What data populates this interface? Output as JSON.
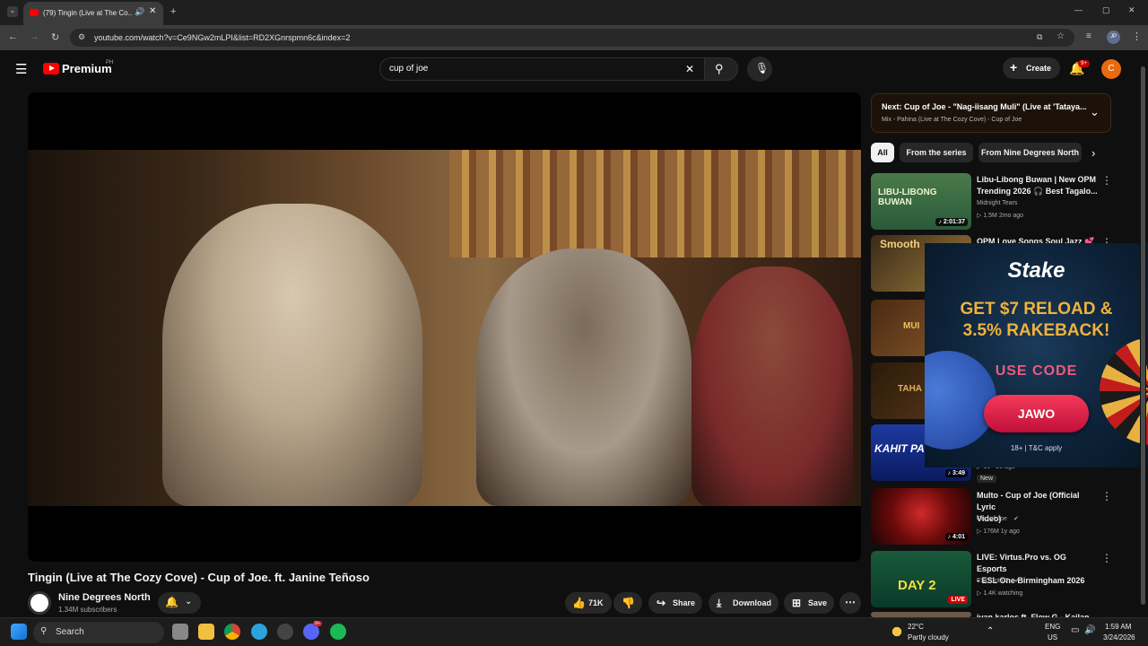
{
  "browser": {
    "tab_title": "(79) Tingin (Live at The Co...",
    "url": "youtube.com/watch?v=Ce9NGw2mLPI&list=RD2XGnrspmn6c&index=2",
    "profile": "JP"
  },
  "header": {
    "brand": "Premium",
    "country": "PH",
    "search_value": "cup of joe",
    "create_label": "Create",
    "notif_count": "9+",
    "avatar_letter": "C"
  },
  "video": {
    "title": "Tingin (Live at The Cozy Cove) - Cup of Joe. ft. Janine Teñoso",
    "channel": "Nine Degrees North",
    "subscribers": "1.34M subscribers",
    "likes": "71K",
    "share_label": "Share",
    "download_label": "Download",
    "save_label": "Save"
  },
  "next": {
    "title": "Next: Cup of Joe - \"Nag-iisang Muli\" (Live at 'Tataya...",
    "mix": "Mix - Pahina (Live at The Cozy Cove) - Cup of Joe"
  },
  "chips": [
    "All",
    "From the series",
    "From Nine Degrees North"
  ],
  "recs": [
    {
      "title_1": "Libu-Libong Buwan | New OPM",
      "title_2": "Trending 2026 🎧 Best Tagalo...",
      "channel": "Midnight Tears",
      "meta": "▷ 1.5M   2mo ago",
      "duration": "♪ 2:01:37",
      "thumb_text": "LIBU-LIBONG BUWAN"
    },
    {
      "title_1": "OPM Love Songs Soul Jazz 💕",
      "thumb_text": "Smooth"
    },
    {
      "thumb_text": "MUI"
    },
    {
      "thumb_text": "TAHA"
    },
    {
      "meta": "▷ 16 · 26 ago",
      "badge": "New",
      "duration": "♪ 3:49",
      "thumb_text": "KAHIT PA"
    },
    {
      "title_1": "Multo - Cup of Joe (Official Lyric",
      "title_2": "Video)",
      "channel": "Cup of Joe",
      "meta": "▷ 176M   1y ago",
      "duration": "♪ 4:01"
    },
    {
      "title_1": "LIVE: Virtus.Pro vs. OG Esports",
      "title_2": "- ESL One Birmingham 2026",
      "channel": "ESL Dota 2",
      "meta": "▷ 1.4K watching",
      "badge": "LIVE",
      "thumb_text": "DAY 2"
    },
    {
      "title_1": "ivan karlos ft. Flow G - Kailan"
    }
  ],
  "ad": {
    "logo": "Stake",
    "headline_1": "GET $7 RELOAD &",
    "headline_2": "3.5% RAKEBACK!",
    "use_code": "USE CODE",
    "code": "JAWO",
    "terms": "18+ | T&C apply"
  },
  "taskbar": {
    "search": "Search",
    "weather_temp": "22°C",
    "weather_desc": "Partly cloudy",
    "lang_1": "ENG",
    "lang_2": "US",
    "time": "1:59 AM",
    "date": "3/24/2026",
    "discord_badge": "9+"
  }
}
